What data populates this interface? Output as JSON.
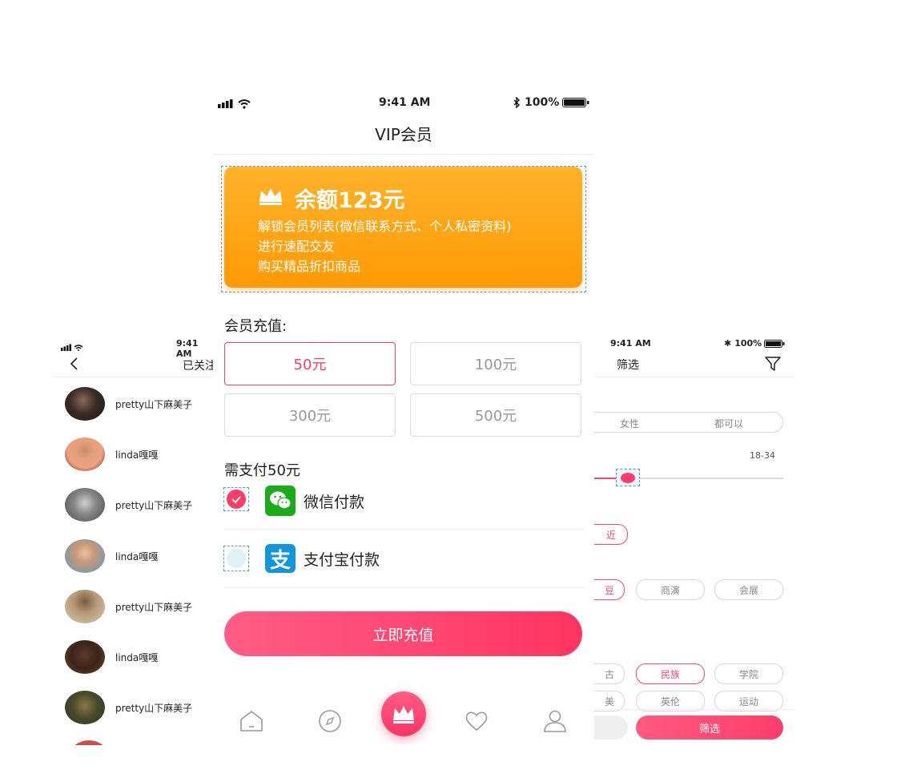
{
  "left_screen": {
    "status_time": "9:41 AM",
    "title": "已关注",
    "rows": [
      {
        "name": "pretty山下麻美子"
      },
      {
        "name": "linda嘎嘎"
      },
      {
        "name": "pretty山下麻美子"
      },
      {
        "name": "linda嘎嘎"
      },
      {
        "name": "pretty山下麻美子"
      },
      {
        "name": "linda嘎嘎"
      },
      {
        "name": "pretty山下麻美子"
      }
    ]
  },
  "right_screen": {
    "status_time": "9:41 AM",
    "battery": "100%",
    "title": "筛选",
    "gender_tags": [
      "女性",
      "都可以"
    ],
    "age_range": "18-34",
    "distance_tag": "近",
    "scene_tags": [
      "豆",
      "商演",
      "会展"
    ],
    "style_tags_row1": [
      "古",
      "民族",
      "学院"
    ],
    "style_tags_row2": [
      "美",
      "英伦",
      "运动"
    ],
    "confirm_button": "筛选"
  },
  "main": {
    "status_time": "9:41 AM",
    "battery": "100%",
    "title": "VIP会员",
    "card": {
      "balance": "余额123元",
      "benefits": [
        "解锁会员列表(微信联系方式、个人私密资料)",
        "进行速配交友",
        "购买精品折扣商品"
      ]
    },
    "recharge_label": "会员充值:",
    "amounts": [
      "50元",
      "100元",
      "300元",
      "500元"
    ],
    "selected_amount_index": 0,
    "pay_label": "需支付50元",
    "payment_methods": [
      {
        "label": "微信付款",
        "checked": true,
        "icon": "wechat-icon"
      },
      {
        "label": "支付宝付款",
        "checked": false,
        "icon": "alipay-icon"
      }
    ],
    "submit_button": "立即充值",
    "tabs": [
      "home-icon",
      "compass-icon",
      "crown-icon",
      "heart-icon",
      "profile-icon"
    ],
    "colors": {
      "accent": "#ff3d6a",
      "card_orange": "#ffa415",
      "wechat": "#1aad19",
      "alipay": "#1296db"
    }
  }
}
